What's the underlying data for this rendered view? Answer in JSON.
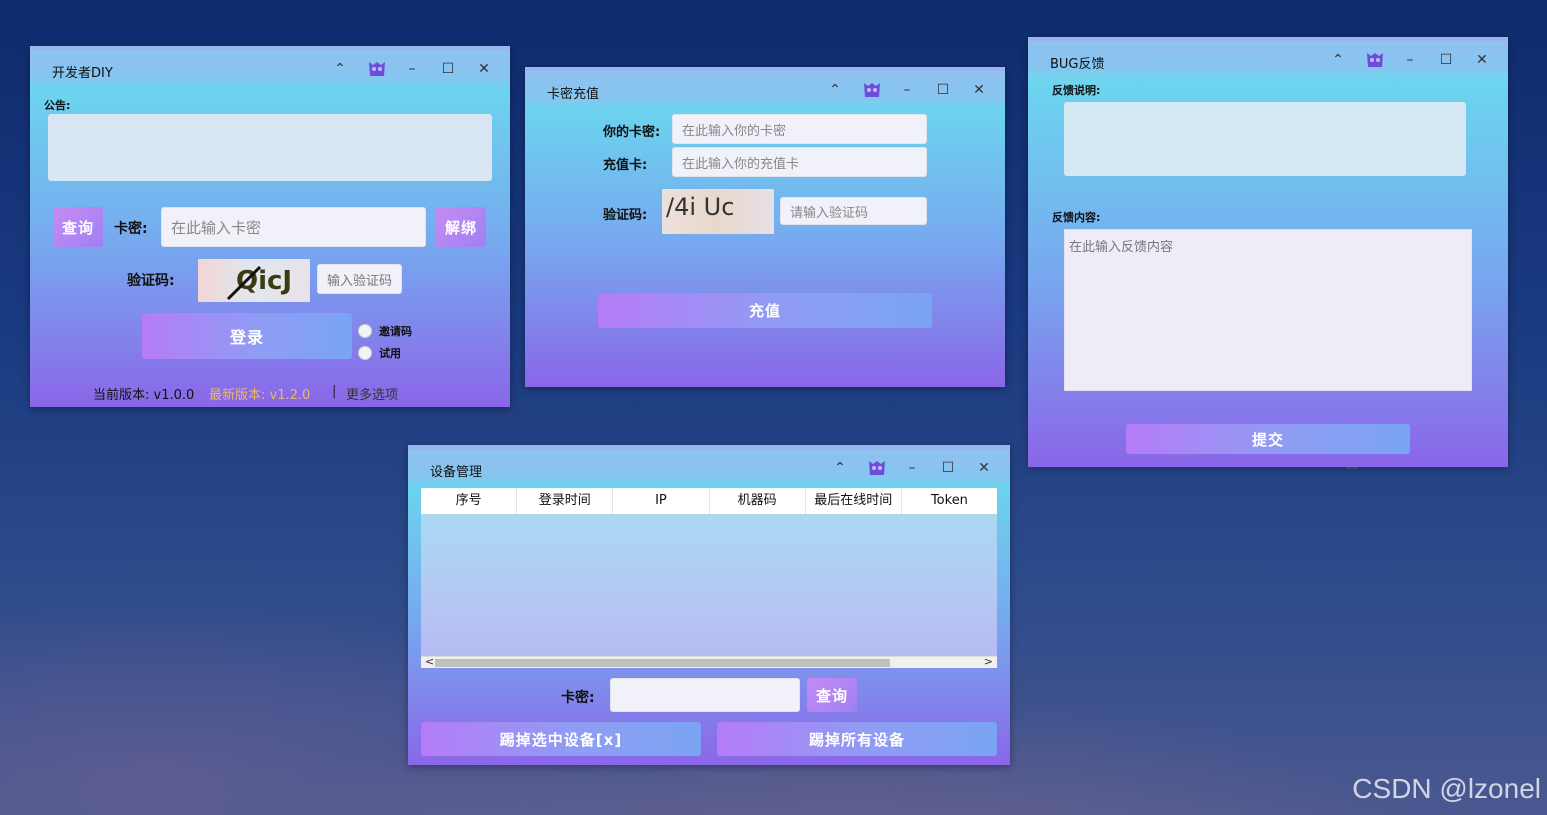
{
  "login": {
    "title": "开发者DIY",
    "notice_label": "公告:",
    "query_btn": "查询",
    "card_label": "卡密:",
    "card_placeholder": "在此输入卡密",
    "unbind_btn": "解绑",
    "captcha_label": "验证码:",
    "captcha_text": "QicJ",
    "captcha_placeholder": "输入验证码",
    "login_btn": "登录",
    "radio_invite": "邀请码",
    "radio_trial": "试用",
    "current_version": "当前版本: v1.0.0",
    "latest_version": "最新版本: v1.2.0",
    "separator": "|",
    "more_options": "更多选项"
  },
  "recharge": {
    "title": "卡密充值",
    "your_card_label": "你的卡密:",
    "your_card_placeholder": "在此输入你的卡密",
    "recharge_card_label": "充值卡:",
    "recharge_card_placeholder": "在此输入你的充值卡",
    "captcha_label": "验证码:",
    "captcha_text": "/4i Uc",
    "captcha_placeholder": "请输入验证码",
    "recharge_btn": "充值"
  },
  "feedback": {
    "title": "BUG反馈",
    "desc_label": "反馈说明:",
    "content_label": "反馈内容:",
    "content_placeholder": "在此输入反馈内容",
    "submit_btn": "提交"
  },
  "devices": {
    "title": "设备管理",
    "columns": [
      "序号",
      "登录时间",
      "IP",
      "机器码",
      "最后在线时间",
      "Token"
    ],
    "card_label": "卡密:",
    "query_btn": "查询",
    "kick_selected_btn": "踢掉选中设备[x]",
    "kick_all_btn": "踢掉所有设备"
  },
  "titlebar_icons": {
    "collapse": "⌃",
    "minimize": "–",
    "maximize": "☐",
    "close": "✕"
  },
  "watermark": "CSDN @lzonel",
  "colors": {
    "accent_purple": "#b57cf6",
    "accent_blue": "#7aa4f3",
    "latest_version": "#e8b86a",
    "window_top": "#6cd3ee",
    "window_bottom": "#8a66e8"
  }
}
